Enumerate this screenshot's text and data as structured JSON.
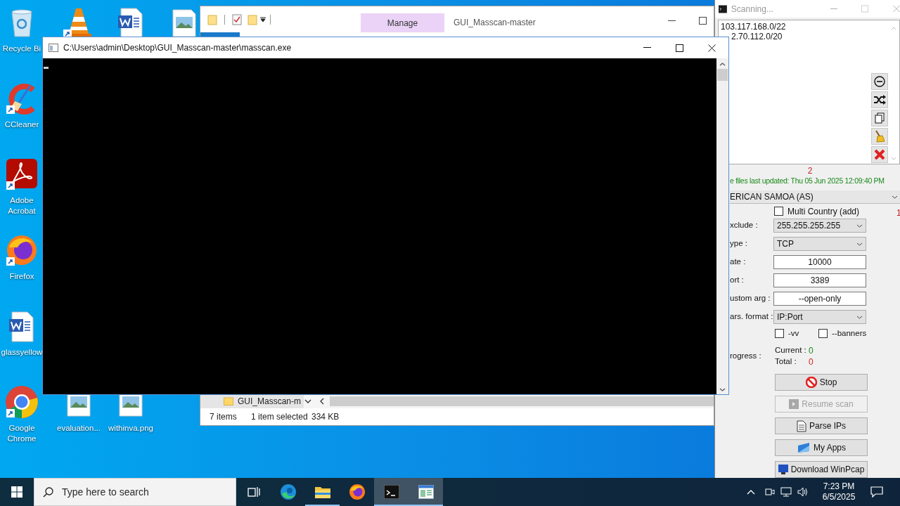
{
  "desktop_icons": [
    {
      "kind": "recycle-bin",
      "label": "Recycle Bi"
    },
    {
      "kind": "cone"
    },
    {
      "kind": "word-doc"
    },
    {
      "kind": "image-file"
    },
    {
      "kind": "ccleaner",
      "label": "CCleaner"
    },
    {
      "kind": "pdf",
      "label": "Adobe Acrobat"
    },
    {
      "kind": "firefox",
      "label": "Firefox"
    },
    {
      "kind": "word-doc",
      "label": "glassyellow"
    },
    {
      "kind": "chrome",
      "label": "Google Chrome"
    },
    {
      "kind": "image-file",
      "label": "evaluation..."
    },
    {
      "kind": "image-file",
      "label": "withinva.png"
    }
  ],
  "explorer": {
    "ribbon_tab": "Manage",
    "title": "GUI_Masscan-master",
    "nav_item": "GUI_Masscan-m",
    "status": [
      "7 items",
      "1 item selected",
      "334 KB"
    ]
  },
  "console": {
    "title": "C:\\Users\\admin\\Desktop\\GUI_Masscan-master\\masscan.exe"
  },
  "scanner": {
    "title": "Scanning...",
    "ranges": [
      "103.117.168.0/22",
      "2.70.112.0/20"
    ],
    "tools": [
      {
        "kind": "remove"
      },
      {
        "kind": "shuffle"
      },
      {
        "kind": "copy"
      },
      {
        "kind": "clean"
      },
      {
        "kind": "delete"
      }
    ],
    "count": "2",
    "updated": "e files last updated: Thu 05 Jun 2025 12:09:40 PM",
    "country": "ERICAN SAMOA (AS)",
    "multi_country": {
      "label": "Multi Country (add)",
      "checked": false
    },
    "country_count": "1",
    "fields": [
      {
        "label": "xclude :",
        "kind": "dropdown",
        "value": "255.255.255.255"
      },
      {
        "label": "ype :",
        "kind": "dropdown",
        "value": "TCP"
      },
      {
        "label": "ate :",
        "kind": "input",
        "value": "10000"
      },
      {
        "label": "ort :",
        "kind": "input",
        "value": "3389"
      },
      {
        "label": "ustom arg :",
        "kind": "input",
        "value": "--open-only"
      },
      {
        "label": "ars. format :",
        "kind": "dropdown",
        "value": "IP:Port"
      }
    ],
    "options": [
      {
        "label": "-vv",
        "checked": false
      },
      {
        "label": "--banners",
        "checked": false
      }
    ],
    "progress_label": "rogress :",
    "current": {
      "label": "Current :",
      "value": "0"
    },
    "total": {
      "label": "Total :",
      "value": "0"
    },
    "buttons": [
      {
        "kind": "stop",
        "label": "Stop",
        "disabled": false
      },
      {
        "kind": "resume",
        "label": "Resume scan",
        "disabled": true
      },
      {
        "kind": "parse",
        "label": "Parse IPs",
        "disabled": false
      },
      {
        "kind": "apps",
        "label": "My Apps",
        "disabled": false
      },
      {
        "kind": "download",
        "label": "Download WinPcap",
        "disabled": false
      }
    ]
  },
  "taskbar": {
    "search_placeholder": "Type here to search",
    "apps": [
      {
        "kind": "task-view",
        "running": false,
        "highlighted": false
      },
      {
        "kind": "edge",
        "running": false,
        "highlighted": false
      },
      {
        "kind": "explorer",
        "running": true,
        "highlighted": false
      },
      {
        "kind": "firefox",
        "running": false,
        "highlighted": false
      },
      {
        "kind": "terminal",
        "running": true,
        "highlighted": true
      },
      {
        "kind": "masscan",
        "running": true,
        "highlighted": true
      }
    ],
    "time": "7:23 PM",
    "date": "6/5/2025"
  }
}
